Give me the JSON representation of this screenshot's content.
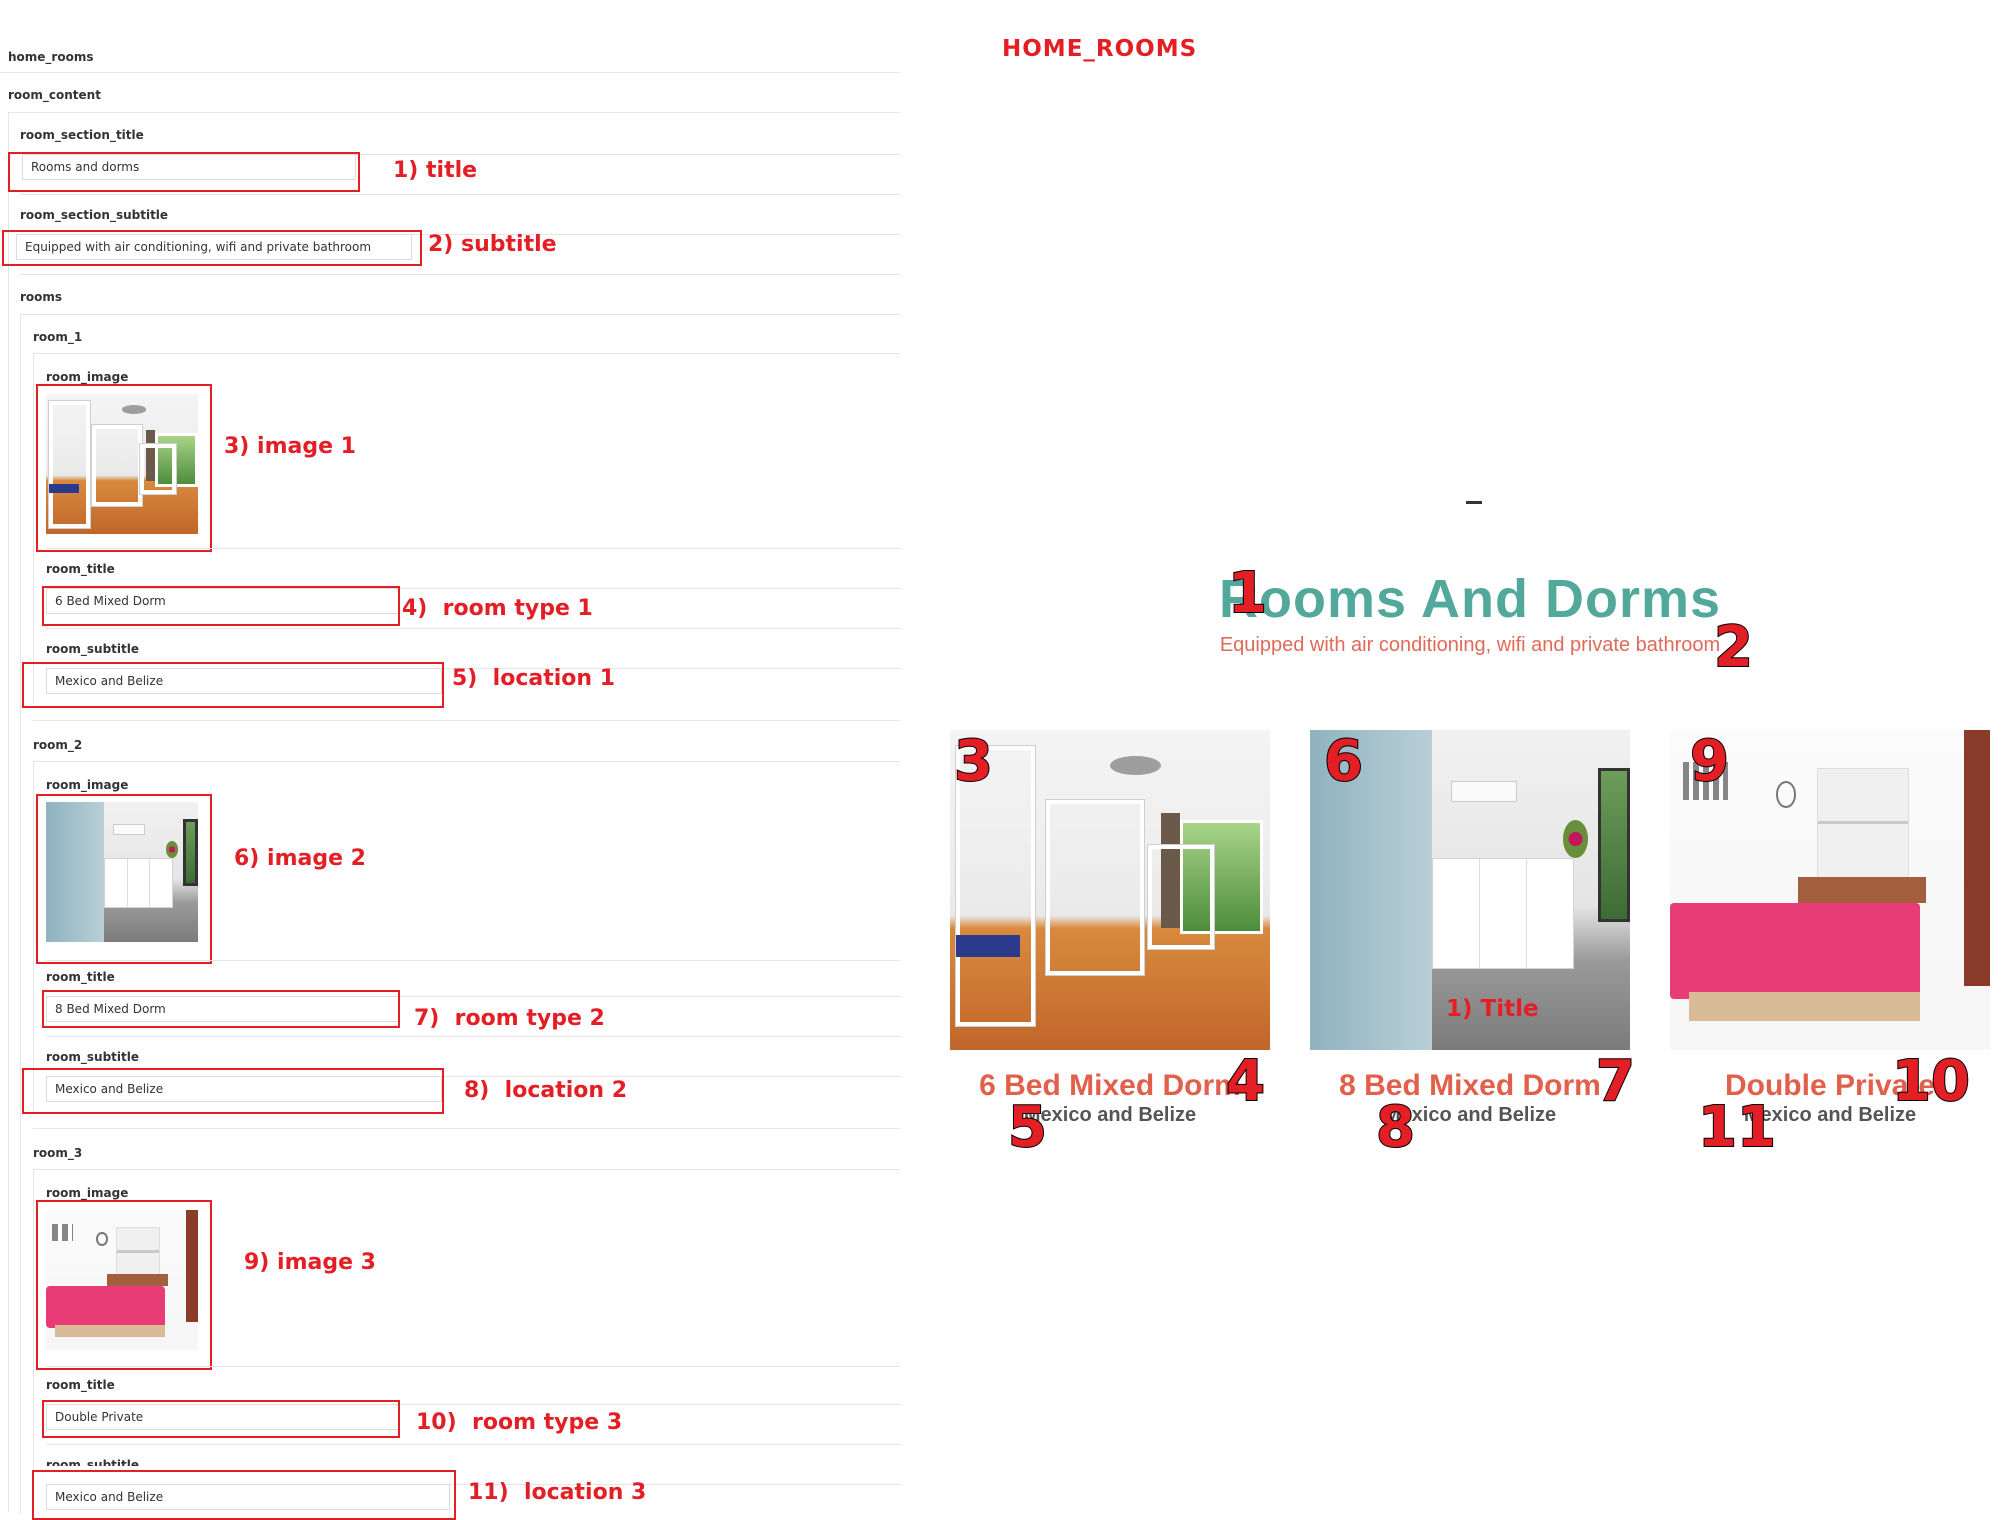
{
  "form": {
    "group_label": "home_rooms",
    "content_label": "room_content",
    "section_title": {
      "label": "room_section_title",
      "value": "Rooms and dorms"
    },
    "section_subtitle": {
      "label": "room_section_subtitle",
      "value": "Equipped with air conditioning, wifi and private bathroom"
    },
    "rooms_label": "rooms",
    "rooms": [
      {
        "label": "room_1",
        "image_label": "room_image",
        "title_label": "room_title",
        "title_value": "6 Bed Mixed Dorm",
        "subtitle_label": "room_subtitle",
        "subtitle_value": "Mexico and Belize"
      },
      {
        "label": "room_2",
        "image_label": "room_image",
        "title_label": "room_title",
        "title_value": "8 Bed Mixed Dorm",
        "subtitle_label": "room_subtitle",
        "subtitle_value": "Mexico and Belize"
      },
      {
        "label": "room_3",
        "image_label": "room_image",
        "title_label": "room_title",
        "title_value": "Double Private",
        "subtitle_label": "room_subtitle",
        "subtitle_value": "Mexico and Belize"
      }
    ]
  },
  "annotations": {
    "a1": "1) title",
    "a2": "2) subtitle",
    "a3": "3) image 1",
    "a4": "4)  room type 1",
    "a5": "5)  location 1",
    "a6": "6) image 2",
    "a7": "7)  room type 2",
    "a8": "8)  location 2",
    "a9": "9) image 3",
    "a10": "10)  room type 3",
    "a11": "11)  location 3"
  },
  "preview": {
    "heading": "HOME_ROOMS",
    "title": "Rooms And Dorms",
    "subtitle": "Equipped with air conditioning, wifi and private bathroom",
    "overlay_label": "1) Title",
    "cards": [
      {
        "title": "6 Bed Mixed Dorm",
        "subtitle": "Mexico and Belize"
      },
      {
        "title": "8 Bed Mixed Dorm",
        "subtitle": "Mexico and Belize"
      },
      {
        "title": "Double Private",
        "subtitle": "Mexico and Belize"
      }
    ],
    "markers": [
      "1",
      "2",
      "3",
      "4",
      "5",
      "6",
      "7",
      "8",
      "9",
      "10",
      "11"
    ]
  },
  "colors": {
    "annotation_red": "#e41e25",
    "title_teal": "#52a89b",
    "accent_coral": "#e2604b"
  }
}
